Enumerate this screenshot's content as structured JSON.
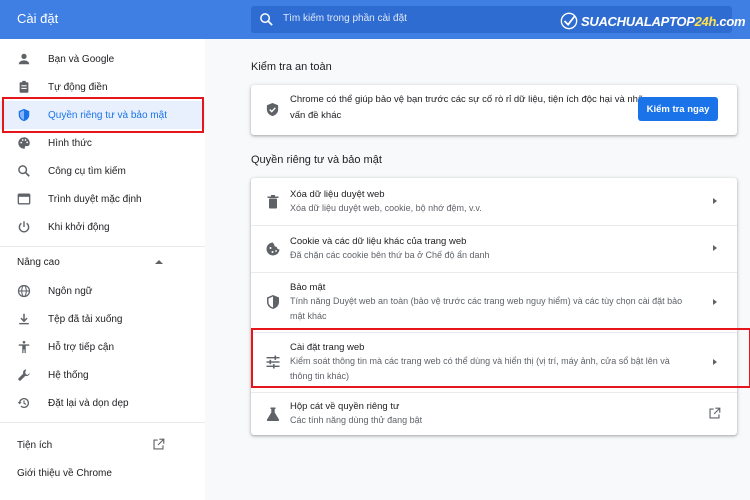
{
  "header": {
    "title": "Cài đặt",
    "search_placeholder": "Tìm kiếm trong phần cài đặt",
    "logo_text_a": "SUACHUALAPTOP",
    "logo_text_b": "24h",
    "logo_text_c": ".com"
  },
  "sidebar": {
    "items": [
      {
        "label": "Bạn và Google",
        "icon": "person-icon"
      },
      {
        "label": "Tự động điền",
        "icon": "clipboard-icon"
      },
      {
        "label": "Quyền riêng tư và bảo mật",
        "icon": "shield-icon"
      },
      {
        "label": "Hình thức",
        "icon": "palette-icon"
      },
      {
        "label": "Công cụ tìm kiếm",
        "icon": "search-icon"
      },
      {
        "label": "Trình duyệt mặc định",
        "icon": "browser-icon"
      },
      {
        "label": "Khi khởi động",
        "icon": "power-icon"
      }
    ],
    "advanced_label": "Nâng cao",
    "advanced_items": [
      {
        "label": "Ngôn ngữ",
        "icon": "globe-icon"
      },
      {
        "label": "Tệp đã tải xuống",
        "icon": "download-icon"
      },
      {
        "label": "Hỗ trợ tiếp cận",
        "icon": "accessibility-icon"
      },
      {
        "label": "Hệ thống",
        "icon": "wrench-icon"
      },
      {
        "label": "Đặt lại và dọn dẹp",
        "icon": "restore-icon"
      }
    ],
    "extensions_label": "Tiện ích",
    "about_label": "Giới thiệu về Chrome"
  },
  "safety": {
    "title": "Kiểm tra an toàn",
    "text_line1": "Chrome có thể giúp bảo vệ bạn trước các sự cố rò rỉ dữ liệu, tiện ích độc hại và những",
    "text_line2": "vấn đề khác",
    "button": "Kiểm tra ngay"
  },
  "privacy": {
    "title": "Quyền riêng tư và bảo mật",
    "rows": [
      {
        "title": "Xóa dữ liệu duyệt web",
        "desc1": "Xóa dữ liệu duyệt web, cookie, bộ nhớ đệm, v.v.",
        "desc2": "",
        "icon": "trash-icon"
      },
      {
        "title": "Cookie và các dữ liệu khác của trang web",
        "desc1": "Đã chặn các cookie bên thứ ba ở Chế độ ẩn danh",
        "desc2": "",
        "icon": "cookie-icon"
      },
      {
        "title": "Bảo mật",
        "desc1": "Tính năng Duyệt web an toàn (bảo vệ trước các trang web nguy hiểm) và các tùy chọn cài đặt bảo",
        "desc2": "mật khác",
        "icon": "shield-icon"
      },
      {
        "title": "Cài đặt trang web",
        "desc1": "Kiểm soát thông tin mà các trang web có thể dùng và hiển thị (vị trí, máy ảnh, cửa sổ bật lên và",
        "desc2": "thông tin khác)",
        "icon": "tune-icon"
      },
      {
        "title": "Hộp cát về quyền riêng tư",
        "desc1": "Các tính năng dùng thử đang bật",
        "desc2": "",
        "icon": "flask-icon"
      }
    ]
  },
  "colors": {
    "accent": "#1a73e8",
    "header": "#3f7fe4",
    "highlight_box": "#e6141b"
  }
}
